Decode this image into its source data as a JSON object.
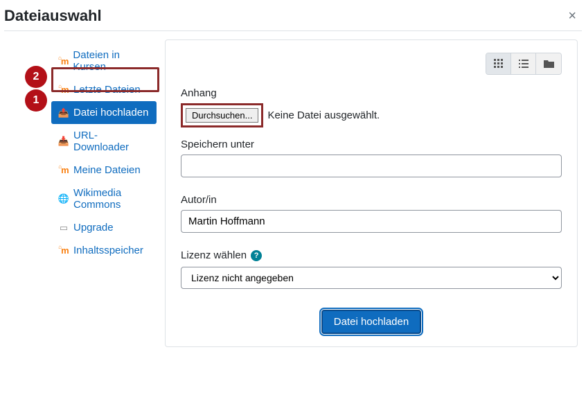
{
  "header": {
    "title": "Dateiauswahl"
  },
  "sidebar": {
    "items": [
      {
        "label": "Dateien in Kursen"
      },
      {
        "label": "Letzte Dateien"
      },
      {
        "label": "Datei hochladen"
      },
      {
        "label": "URL-Downloader"
      },
      {
        "label": "Meine Dateien"
      },
      {
        "label": "Wikimedia Commons"
      },
      {
        "label": "Upgrade"
      },
      {
        "label": "Inhaltsspeicher"
      }
    ]
  },
  "annotations": {
    "badge1": "1",
    "badge2": "2"
  },
  "form": {
    "attachment_label": "Anhang",
    "browse_button": "Durchsuchen...",
    "no_file_text": "Keine Datei ausgewählt.",
    "save_as_label": "Speichern unter",
    "save_as_value": "",
    "author_label": "Autor/in",
    "author_value": "Martin Hoffmann",
    "license_label": "Lizenz wählen",
    "license_value": "Lizenz nicht angegeben",
    "submit_label": "Datei hochladen"
  }
}
